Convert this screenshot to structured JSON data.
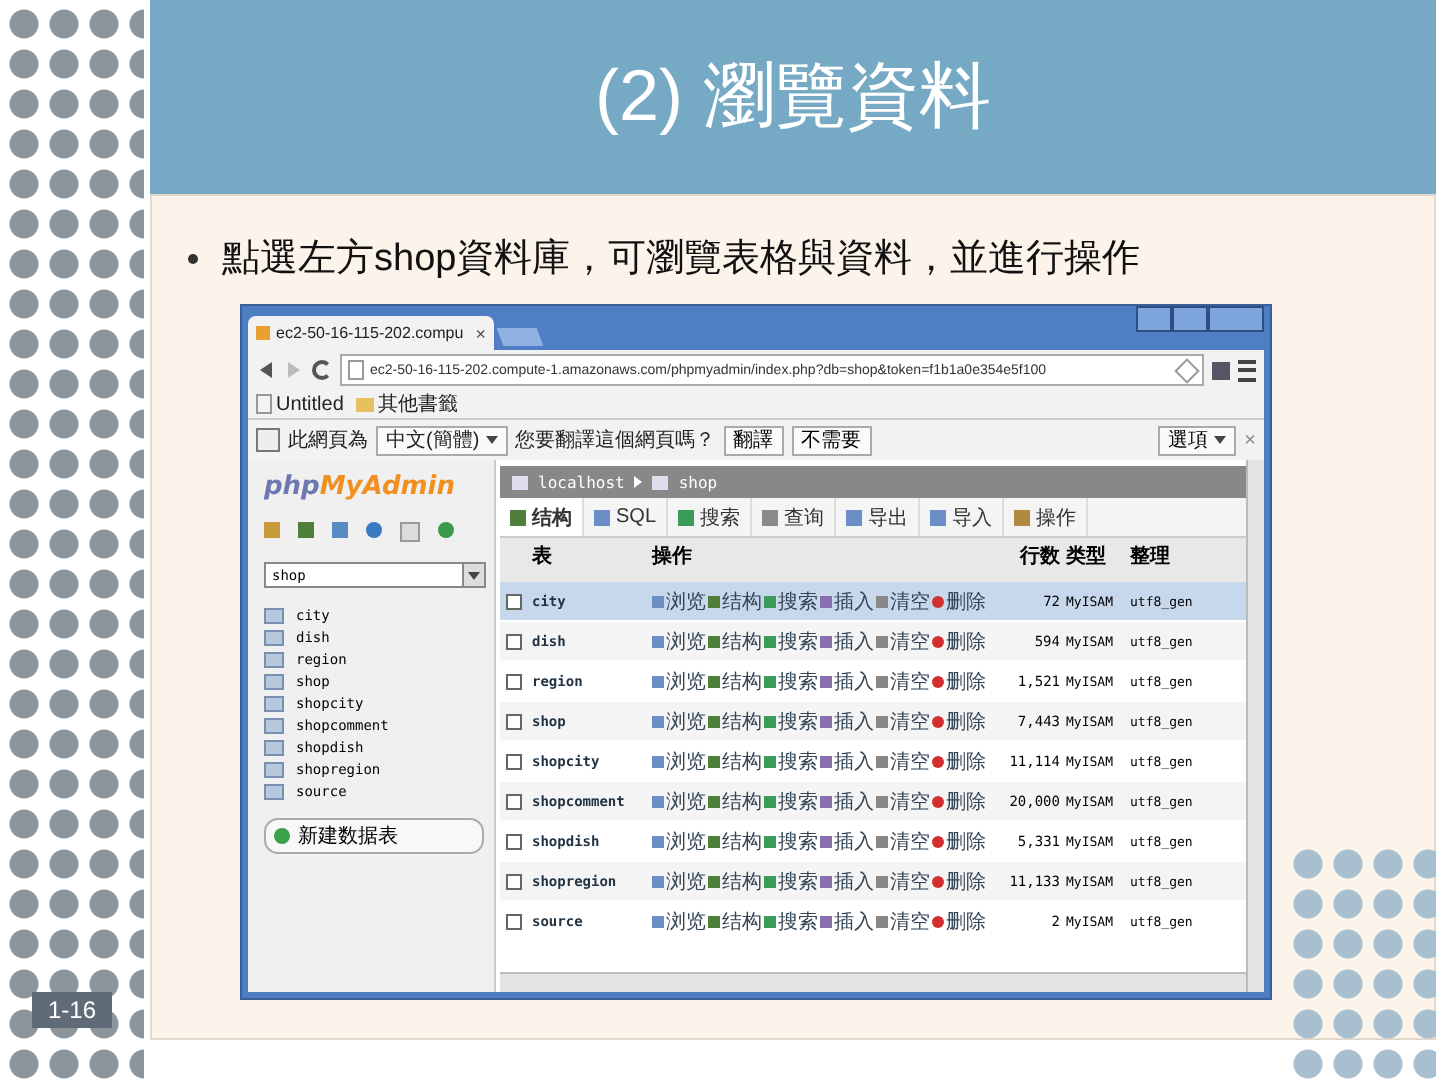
{
  "slide": {
    "title": "(2) 瀏覽資料",
    "bullet": "點選左方shop資料庫，可瀏覽表格與資料，並進行操作",
    "number": "1-16"
  },
  "browser": {
    "tab_title": "ec2-50-16-115-202.compu",
    "tab_close": "×",
    "address": "ec2-50-16-115-202.compute-1.amazonaws.com/phpmyadmin/index.php?db=shop&token=f1b1a0e354e5f100",
    "bookmarks": [
      "Untitled",
      "其他書籤"
    ],
    "translate_bar": {
      "label": "此網頁為",
      "language": "中文(簡體)",
      "question": "您要翻譯這個網頁嗎？",
      "translate": "翻譯",
      "decline": "不需要",
      "options": "選項",
      "close": "×"
    }
  },
  "sidebar": {
    "logo_php": "php",
    "logo_rest": "MyAdmin",
    "database": "shop",
    "tables": [
      "city",
      "dish",
      "region",
      "shop",
      "shopcity",
      "shopcomment",
      "shopdish",
      "shopregion",
      "source"
    ],
    "new_table": "新建数据表"
  },
  "main": {
    "breadcrumb": [
      "localhost",
      "shop"
    ],
    "tabs": [
      {
        "label": "结构",
        "selected": true
      },
      {
        "label": "SQL",
        "selected": false
      },
      {
        "label": "搜索",
        "selected": false
      },
      {
        "label": "查询",
        "selected": false
      },
      {
        "label": "导出",
        "selected": false
      },
      {
        "label": "导入",
        "selected": false
      },
      {
        "label": "操作",
        "selected": false
      }
    ],
    "columns": [
      "表",
      "操作",
      "行数",
      "类型",
      "整理"
    ],
    "rows": [
      {
        "name": "city",
        "selected": true,
        "checked": false,
        "actions": [
          "浏览",
          "结构",
          "搜索",
          "插入",
          "清空",
          "删除"
        ],
        "count": "72",
        "type": "MyISAM",
        "collation": "utf8_gen"
      },
      {
        "name": "dish",
        "selected": false,
        "checked": false,
        "actions": [
          "浏览",
          "结构",
          "搜索",
          "插入",
          "清空",
          "删除"
        ],
        "count": "594",
        "type": "MyISAM",
        "collation": "utf8_gen"
      },
      {
        "name": "region",
        "selected": false,
        "checked": false,
        "actions": [
          "浏览",
          "结构",
          "搜索",
          "插入",
          "清空",
          "删除"
        ],
        "count": "1,521",
        "type": "MyISAM",
        "collation": "utf8_gen"
      },
      {
        "name": "shop",
        "selected": false,
        "checked": false,
        "actions": [
          "浏览",
          "结构",
          "搜索",
          "插入",
          "清空",
          "删除"
        ],
        "count": "7,443",
        "type": "MyISAM",
        "collation": "utf8_gen"
      },
      {
        "name": "shopcity",
        "selected": false,
        "checked": false,
        "actions": [
          "浏览",
          "结构",
          "搜索",
          "插入",
          "清空",
          "删除"
        ],
        "count": "11,114",
        "type": "MyISAM",
        "collation": "utf8_gen"
      },
      {
        "name": "shopcomment",
        "selected": false,
        "checked": false,
        "actions": [
          "浏览",
          "结构",
          "搜索",
          "插入",
          "清空",
          "删除"
        ],
        "count": "20,000",
        "type": "MyISAM",
        "collation": "utf8_gen"
      },
      {
        "name": "shopdish",
        "selected": false,
        "checked": false,
        "actions": [
          "浏览",
          "结构",
          "搜索",
          "插入",
          "清空",
          "删除"
        ],
        "count": "5,331",
        "type": "MyISAM",
        "collation": "utf8_gen"
      },
      {
        "name": "shopregion",
        "selected": false,
        "checked": false,
        "actions": [
          "浏览",
          "结构",
          "搜索",
          "插入",
          "清空",
          "删除"
        ],
        "count": "11,133",
        "type": "MyISAM",
        "collation": "utf8_gen"
      },
      {
        "name": "source",
        "selected": false,
        "checked": false,
        "actions": [
          "浏览",
          "结构",
          "搜索",
          "插入",
          "清空",
          "删除"
        ],
        "count": "2",
        "type": "MyISAM",
        "collation": "utf8_gen"
      }
    ]
  }
}
